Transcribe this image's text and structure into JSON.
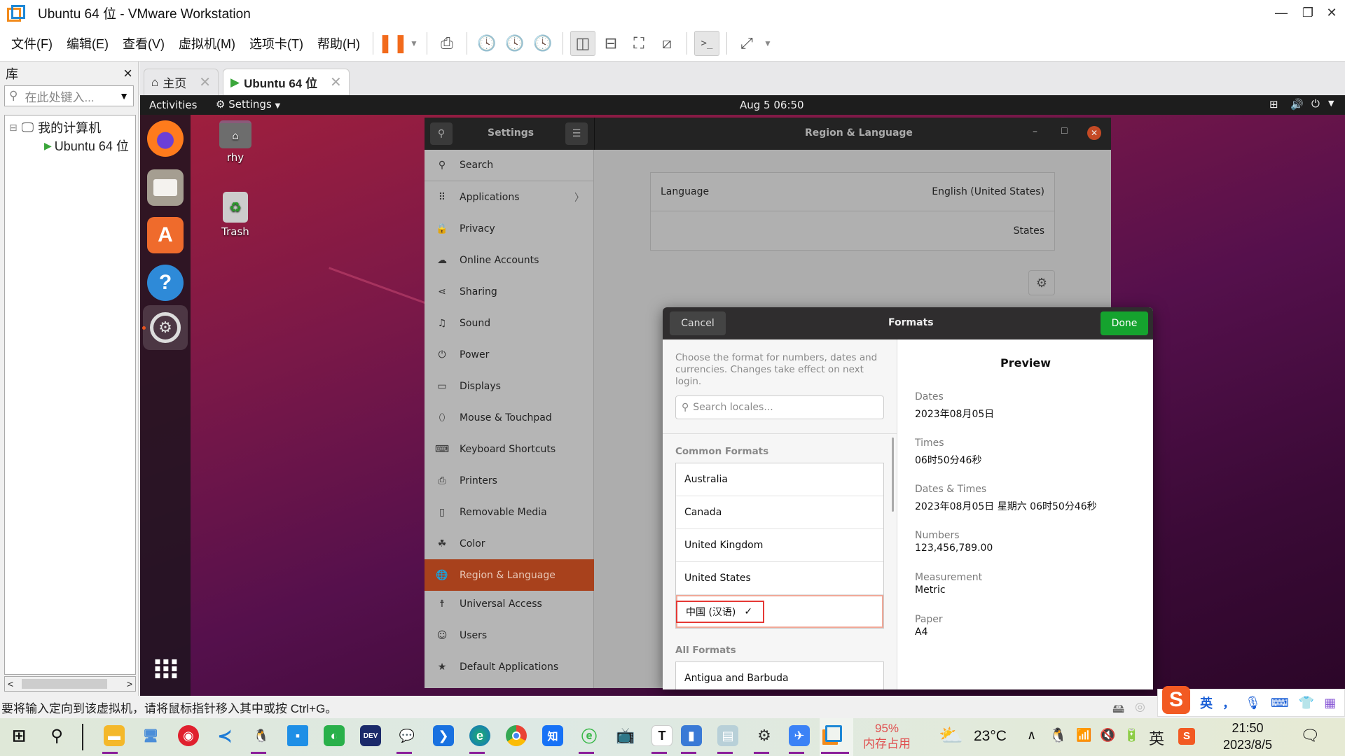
{
  "window": {
    "title": "Ubuntu 64 位 - VMware Workstation",
    "controls": {
      "minimize": "—",
      "restore": "❐",
      "close": "✕"
    }
  },
  "menubar": {
    "items": [
      "文件(F)",
      "编辑(E)",
      "查看(V)",
      "虚拟机(M)",
      "选项卡(T)",
      "帮助(H)"
    ],
    "toolbar_icons": [
      "pause-icon",
      "dropdown-icon",
      "send-ctrl-alt-del-icon",
      "snapshot-icon",
      "revert-snapshot-icon",
      "manage-snapshots-icon",
      "library-view-icon",
      "thumbnail-view-icon",
      "fullscreen-icon",
      "unity-icon",
      "console-icon",
      "stretch-icon",
      "dropdown-icon"
    ]
  },
  "library": {
    "title": "库",
    "close": "×",
    "search_placeholder": "在此处键入...",
    "tree": {
      "root_toggle": "⊟",
      "root_label": "我的计算机",
      "vm_label": "Ubuntu 64 位"
    },
    "scroll_left": "<",
    "scroll_right": ">"
  },
  "tabs": [
    {
      "label": "主页",
      "close": "✕",
      "active": false
    },
    {
      "label": "Ubuntu 64 位",
      "close": "✕",
      "active": true
    }
  ],
  "gnome": {
    "activities": "Activities",
    "app_menu": "Settings",
    "clock": "Aug 5  06:50",
    "dock": [
      "firefox",
      "files",
      "software",
      "help",
      "settings"
    ],
    "desktop_icons": [
      {
        "label": "rhy",
        "icon": "home-folder-icon"
      },
      {
        "label": "Trash",
        "icon": "trash-icon"
      }
    ]
  },
  "settings": {
    "sidebar_title": "Settings",
    "page_title": "Region & Language",
    "sidebar": [
      {
        "label": "Search",
        "icon": "search-icon"
      },
      {
        "label": "Applications",
        "icon": "grid-icon",
        "chevron": "〉"
      },
      {
        "label": "Privacy",
        "icon": "lock-icon"
      },
      {
        "label": "Online Accounts",
        "icon": "cloud-icon"
      },
      {
        "label": "Sharing",
        "icon": "share-icon"
      },
      {
        "label": "Sound",
        "icon": "music-icon"
      },
      {
        "label": "Power",
        "icon": "power-icon"
      },
      {
        "label": "Displays",
        "icon": "display-icon"
      },
      {
        "label": "Mouse & Touchpad",
        "icon": "mouse-icon"
      },
      {
        "label": "Keyboard Shortcuts",
        "icon": "keyboard-icon"
      },
      {
        "label": "Printers",
        "icon": "printer-icon"
      },
      {
        "label": "Removable Media",
        "icon": "usb-icon"
      },
      {
        "label": "Color",
        "icon": "color-icon"
      },
      {
        "label": "Region & Language",
        "icon": "globe-icon",
        "selected": true
      },
      {
        "label": "Universal Access",
        "icon": "accessibility-icon"
      },
      {
        "label": "Users",
        "icon": "users-icon"
      },
      {
        "label": "Default Applications",
        "icon": "star-icon"
      }
    ],
    "content": {
      "language_label": "Language",
      "language_value": "English (United States)",
      "formats_value_partial": "States"
    }
  },
  "formats_dialog": {
    "title": "Formats",
    "cancel": "Cancel",
    "done": "Done",
    "description": "Choose the format for numbers, dates and currencies. Changes take effect on next login.",
    "search_placeholder": "Search locales...",
    "common_heading": "Common Formats",
    "common": [
      "Australia",
      "Canada",
      "United Kingdom",
      "United States",
      "中国 (汉语)"
    ],
    "selected": "中国 (汉语)",
    "all_heading": "All Formats",
    "all": [
      "Antigua and Barbuda"
    ],
    "preview": {
      "title": "Preview",
      "items": [
        {
          "label": "Dates",
          "value": "2023年08月05日"
        },
        {
          "label": "Times",
          "value": "06时50分46秒"
        },
        {
          "label": "Dates & Times",
          "value": "2023年08月05日 星期六 06时50分46秒"
        },
        {
          "label": "Numbers",
          "value": "123,456,789.00"
        },
        {
          "label": "Measurement",
          "value": "Metric"
        },
        {
          "label": "Paper",
          "value": "A4"
        }
      ]
    }
  },
  "statusbar": {
    "message": "要将输入定向到该虚拟机，请将鼠标指针移入其中或按 Ctrl+G。"
  },
  "ime": {
    "lang": "英",
    "punct": "，"
  },
  "taskbar": {
    "memory_percent": "95%",
    "memory_label": "内存占用",
    "temperature": "23°C",
    "tray_lang": "英",
    "time": "21:50",
    "date": "2023/8/5",
    "colors": {
      "accent_underline": "#8a1f9a",
      "memory_text": "#e05050"
    }
  }
}
